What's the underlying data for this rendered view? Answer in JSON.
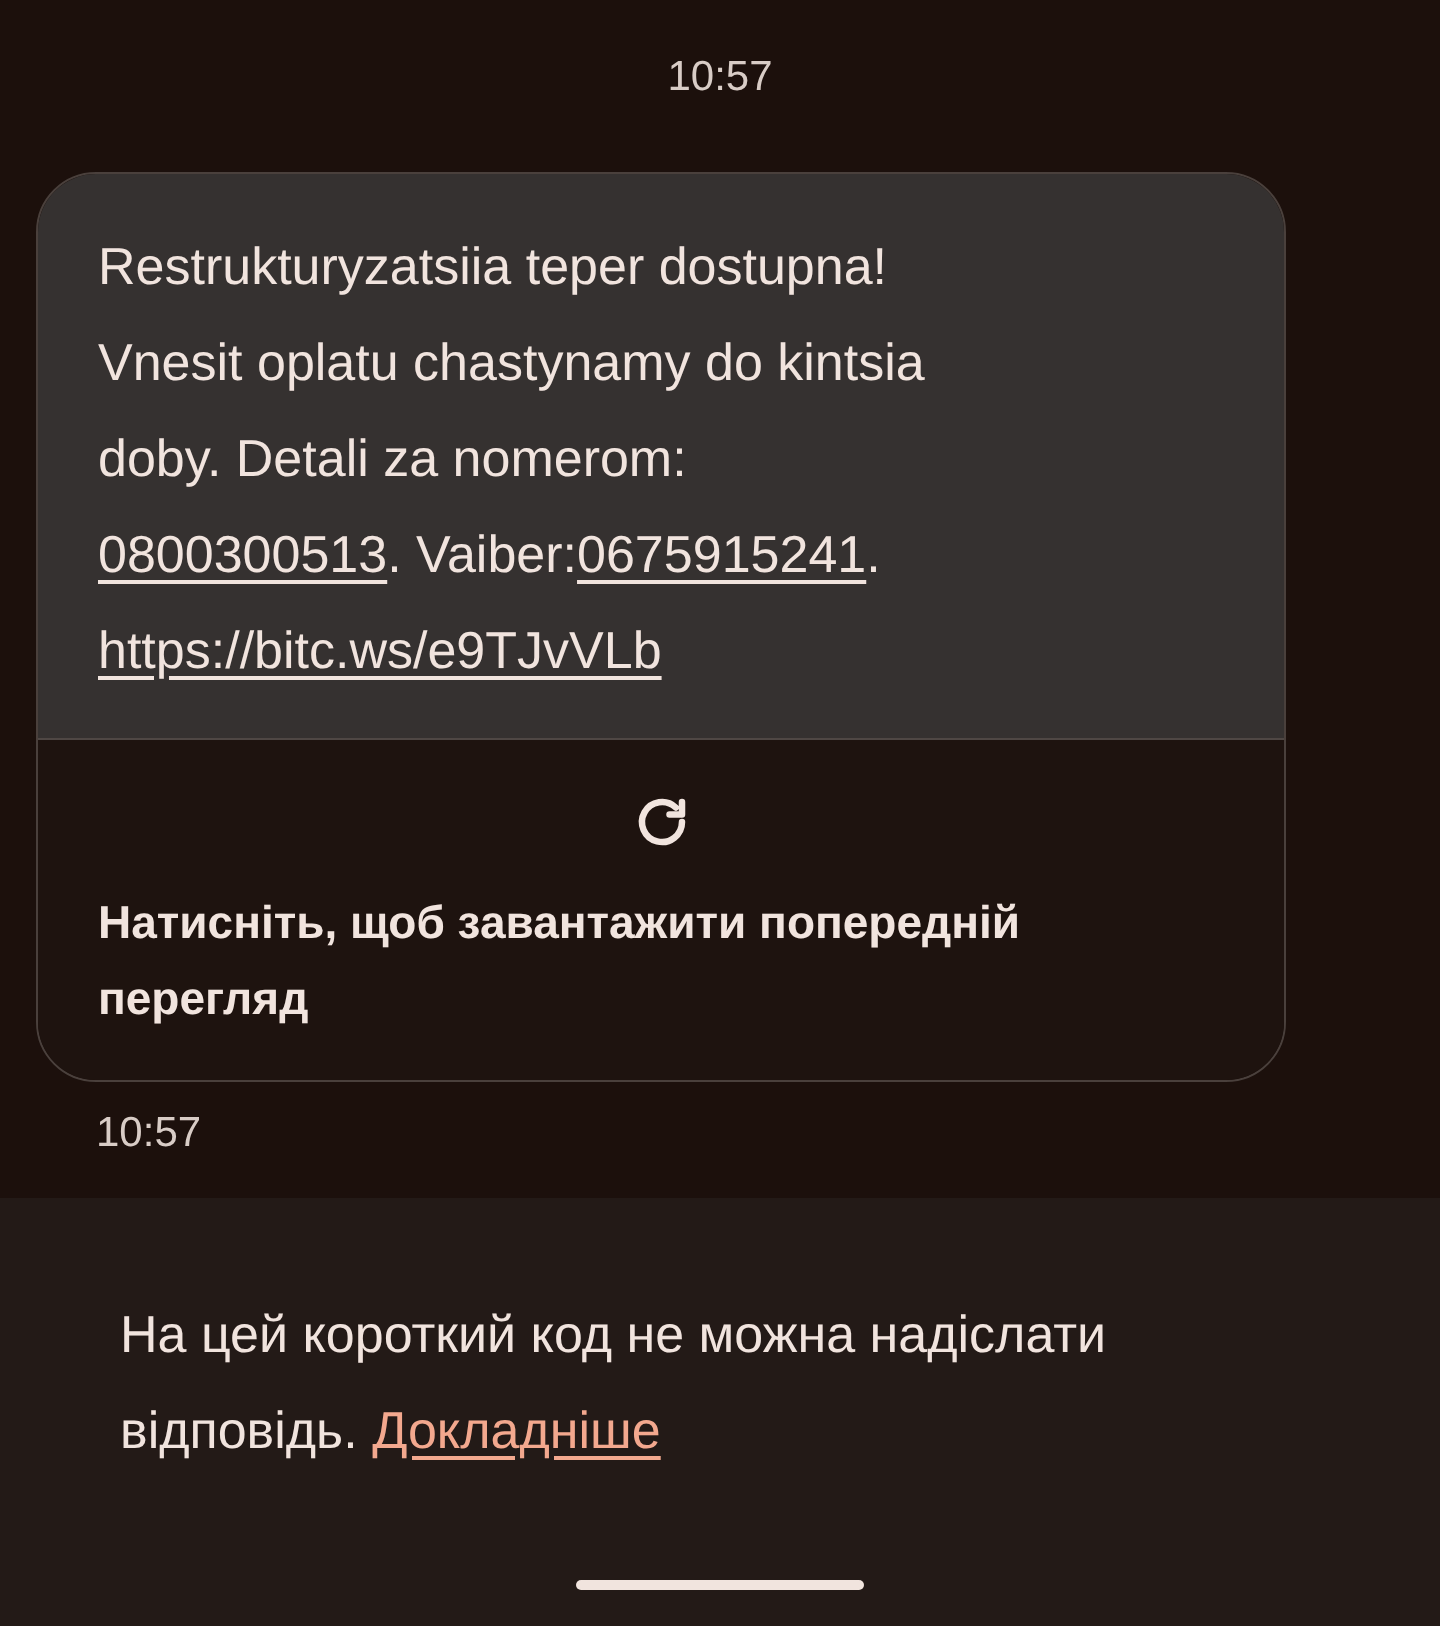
{
  "header_time": "10:57",
  "message": {
    "lines": [
      [
        {
          "kind": "text",
          "text": "Restrukturyzatsiia teper dostupna!"
        }
      ],
      [
        {
          "kind": "text",
          "text": "Vnesit oplatu chastynamy do kintsia"
        }
      ],
      [
        {
          "kind": "text",
          "text": "doby. Detali za nomerom:"
        }
      ],
      [
        {
          "kind": "link",
          "text": "0800300513"
        },
        {
          "kind": "text",
          "text": ". Vaiber:"
        },
        {
          "kind": "link",
          "text": "0675915241"
        },
        {
          "kind": "text",
          "text": "."
        }
      ],
      [
        {
          "kind": "link",
          "text": "https://bitc.ws/e9TJvVLb"
        }
      ]
    ],
    "preview_prompt": "Натисніть, щоб завантажити попередній перегляд",
    "time": "10:57"
  },
  "notice": {
    "text": "На цей короткий код не можна надіслати відповідь.",
    "link": "Докладніше"
  }
}
